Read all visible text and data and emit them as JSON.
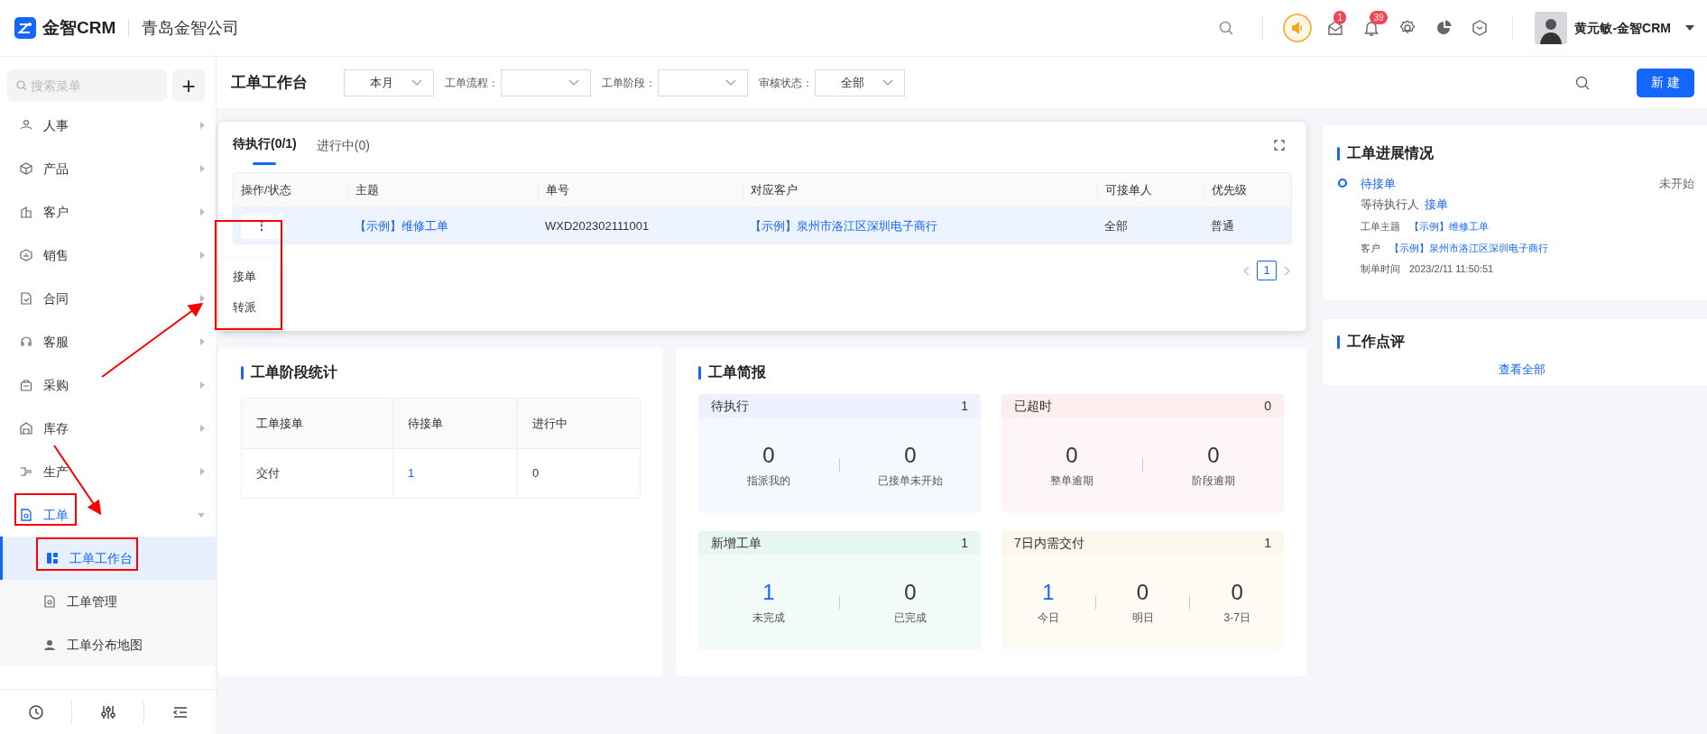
{
  "header": {
    "brand": "金智CRM",
    "company": "青岛金智公司",
    "mail_badge": "1",
    "bell_badge": "39",
    "user": "黄元敏-金智CRM"
  },
  "sidebar": {
    "search": {
      "placeholder": "搜索菜单"
    },
    "add": "+",
    "items": [
      {
        "label": "人事",
        "expanded": false
      },
      {
        "label": "产品",
        "expanded": false
      },
      {
        "label": "客户",
        "expanded": false
      },
      {
        "label": "销售",
        "expanded": false
      },
      {
        "label": "合同",
        "expanded": false
      },
      {
        "label": "客服",
        "expanded": false
      },
      {
        "label": "采购",
        "expanded": false
      },
      {
        "label": "库存",
        "expanded": false
      },
      {
        "label": "生产",
        "expanded": false
      },
      {
        "label": "工单",
        "expanded": true,
        "children": [
          {
            "label": "工单工作台",
            "selected": true
          },
          {
            "label": "工单管理",
            "selected": false
          },
          {
            "label": "工单分布地图",
            "selected": false
          }
        ]
      }
    ]
  },
  "toolbar": {
    "title": "工单工作台",
    "filters": [
      {
        "value": "本月"
      },
      {
        "label": "工单流程："
      },
      {
        "label": "工单阶段："
      },
      {
        "label": "审核状态：",
        "value": "全部"
      }
    ],
    "new_button": "新 建"
  },
  "tasks": {
    "tabs": [
      {
        "label": "待执行(0/1)",
        "selected": true
      },
      {
        "label": "进行中(0)",
        "selected": false
      }
    ],
    "table": {
      "columns": [
        "操作/状态",
        "主题",
        "单号",
        "对应客户",
        "可接单人",
        "优先级"
      ],
      "rows": [
        {
          "cells": [
            {
              "text": "⋮",
              "kind": "button"
            },
            {
              "text": "【示例】维修工单",
              "link": true
            },
            {
              "text": "WXD202302111001",
              "link": false
            },
            {
              "text": "【示例】泉州市洛江区深圳电子商行",
              "link": true
            },
            {
              "text": "全部",
              "link": false
            },
            {
              "text": "普通",
              "link": false
            }
          ]
        }
      ]
    },
    "row_menu": [
      "接单",
      "转派"
    ],
    "pagination": [
      {
        "label": "1",
        "selected": true
      }
    ]
  },
  "stage_stats": {
    "title": "工单阶段统计",
    "columns": [
      "工单接单",
      "待接单",
      "进行中"
    ],
    "rows": [
      [
        {
          "text": "交付",
          "link": false
        },
        {
          "text": "1",
          "link": true
        },
        {
          "text": "0",
          "link": false
        }
      ]
    ]
  },
  "brief": {
    "title": "工单简报",
    "blocks": [
      {
        "title": "待执行",
        "count": "1",
        "color": "#edf1fd",
        "metrics": [
          {
            "value": "0",
            "label": "指派我的",
            "highlighted": false
          },
          {
            "value": "0",
            "label": "已接单未开始",
            "highlighted": false
          }
        ]
      },
      {
        "title": "已超时",
        "count": "0",
        "color": "#fdeeee",
        "metrics": [
          {
            "value": "0",
            "label": "整单逾期",
            "highlighted": false
          },
          {
            "value": "0",
            "label": "阶段逾期",
            "highlighted": false
          }
        ]
      },
      {
        "title": "新增工单",
        "count": "1",
        "color": "#e6f7f1",
        "metrics": [
          {
            "value": "1",
            "label": "未完成",
            "highlighted": true
          },
          {
            "value": "0",
            "label": "已完成",
            "highlighted": false
          }
        ]
      },
      {
        "title": "7日内需交付",
        "count": "1",
        "color": "#fdf6ea",
        "metrics": [
          {
            "value": "1",
            "label": "今日",
            "highlighted": true
          },
          {
            "value": "0",
            "label": "明日",
            "highlighted": false
          },
          {
            "value": "0",
            "label": "3-7日",
            "highlighted": false
          }
        ]
      }
    ]
  },
  "progress": {
    "title": "工单进展情况",
    "steps": [
      {
        "name": "待接单",
        "status": "未开始",
        "waiting_label": "等待执行人",
        "action": "接单",
        "fields": [
          {
            "label": "工单主题",
            "value": "【示例】维修工单",
            "link": true
          },
          {
            "label": "客户",
            "value": "【示例】泉州市洛江区深圳电子商行",
            "link": true
          },
          {
            "label": "制单时间",
            "value": "2023/2/11 11:50:51",
            "link": false
          }
        ]
      }
    ]
  },
  "review": {
    "title": "工作点评",
    "link": "查看全部"
  }
}
